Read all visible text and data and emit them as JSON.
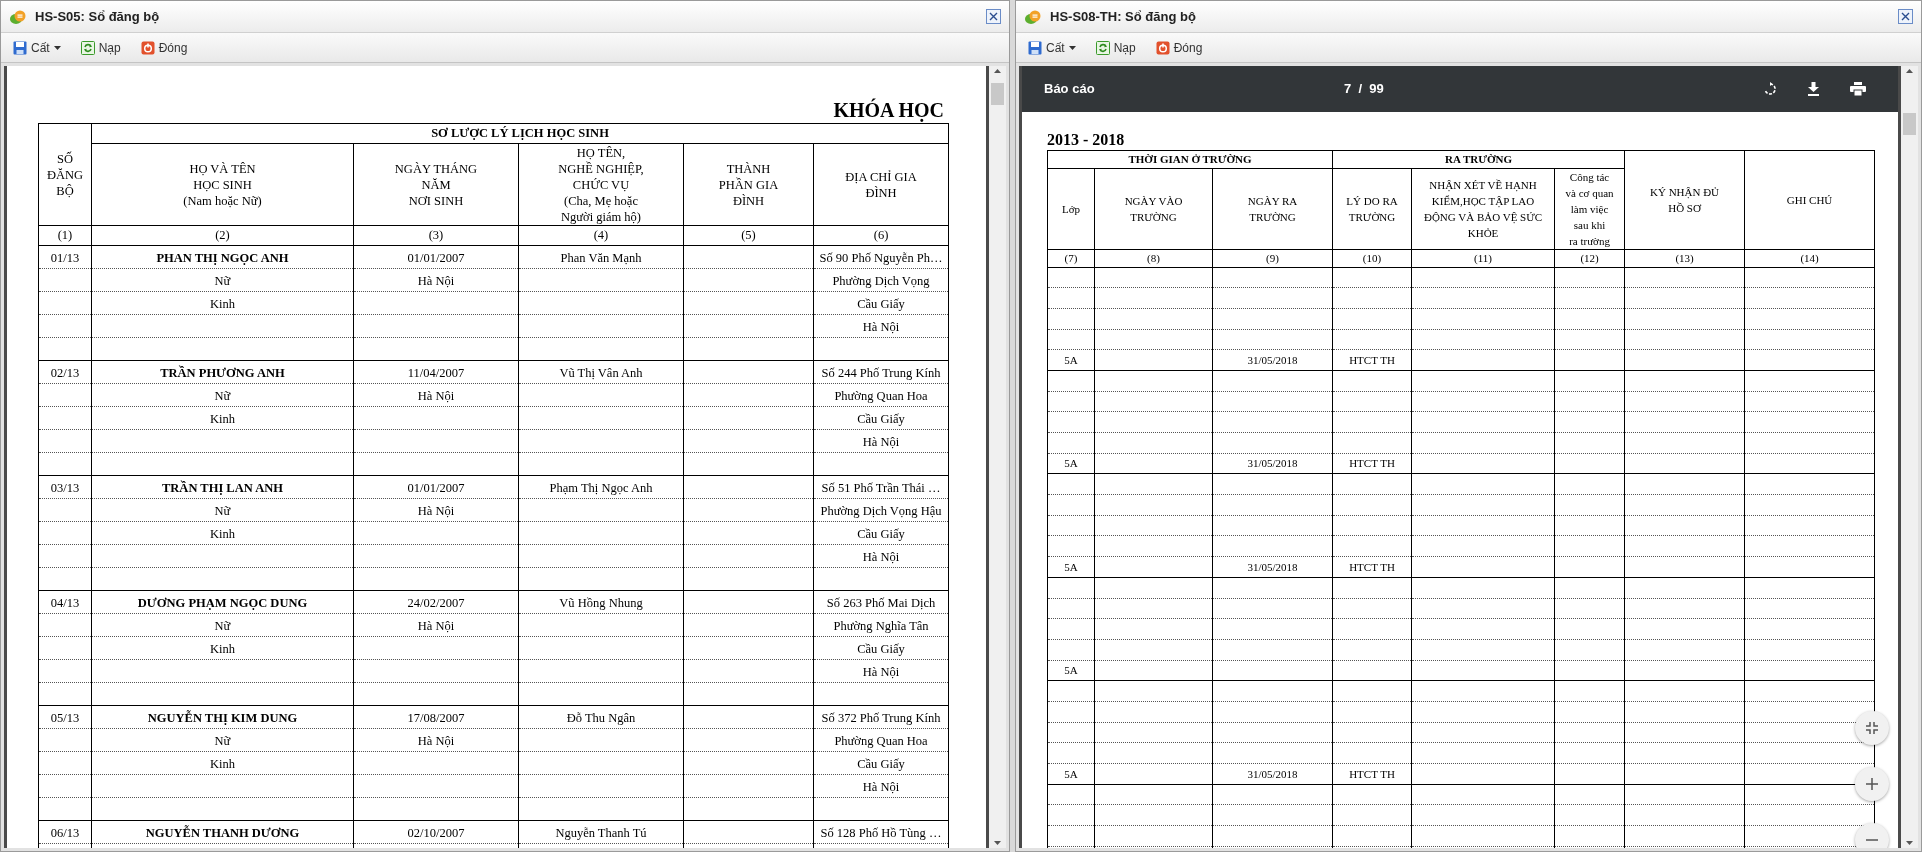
{
  "windows": [
    {
      "title": "HS-S05: Sổ đăng bộ",
      "kind": "register",
      "toolbar": [
        {
          "label": "Cất",
          "kind": "save",
          "has_menu": true
        },
        {
          "label": "Nạp",
          "kind": "reload",
          "has_menu": false
        },
        {
          "label": "Đóng",
          "kind": "close",
          "has_menu": false
        }
      ],
      "report": {
        "heading": "KHÓA HỌC",
        "first_column": {
          "heading": "SỐ\nĐĂNG\nBỘ",
          "number": "(1)"
        },
        "header_group": {
          "label": "SƠ LƯỢC LÝ LỊCH HỌC SINH",
          "columns": [
            {
              "heading": "HỌ VÀ TÊN\nHỌC SINH\n(Nam hoặc Nữ)",
              "number": "(2)"
            },
            {
              "heading": "NGÀY THÁNG\nNĂM\nNƠI SINH",
              "number": "(3)"
            },
            {
              "heading": "HỌ TÊN,\nNGHỀ NGHIỆP,\nCHỨC VỤ\n(Cha, Mẹ hoặc\nNgười giám hộ)",
              "number": "(4)"
            },
            {
              "heading": "THÀNH\nPHẦN GIA\nĐÌNH",
              "number": "(5)"
            },
            {
              "heading": "ĐỊA CHỈ GIA\nĐÌNH",
              "number": "(6)"
            }
          ]
        },
        "students": [
          {
            "register_no": "01/13",
            "name": "PHAN THỊ NGỌC ANH",
            "birth_date": "01/01/2007",
            "guardian": "Phan Văn Mạnh",
            "gender": "Nữ",
            "birth_place": "Hà Nội",
            "ethnicity": "Kinh",
            "address": [
              "Số 90 Phố Nguyễn Ph…",
              "Phường Dịch Vọng",
              "Cầu Giấy",
              "Hà Nội"
            ]
          },
          {
            "register_no": "02/13",
            "name": "TRẦN PHƯƠNG ANH",
            "birth_date": "11/04/2007",
            "guardian": "Vũ Thị Vân Anh",
            "gender": "Nữ",
            "birth_place": "Hà Nội",
            "ethnicity": "Kinh",
            "address": [
              "Số 244 Phố Trung Kính",
              "Phường Quan Hoa",
              "Cầu Giấy",
              "Hà Nội"
            ]
          },
          {
            "register_no": "03/13",
            "name": "TRẦN THỊ LAN ANH",
            "birth_date": "01/01/2007",
            "guardian": "Phạm Thị Ngọc Anh",
            "gender": "Nữ",
            "birth_place": "Hà Nội",
            "ethnicity": "Kinh",
            "address": [
              "Số 51 Phố Trần Thái …",
              "Phường Dịch Vọng Hậu",
              "Cầu Giấy",
              "Hà Nội"
            ]
          },
          {
            "register_no": "04/13",
            "name": "DƯƠNG PHẠM NGỌC DUNG",
            "birth_date": "24/02/2007",
            "guardian": "Vũ Hồng Nhung",
            "gender": "Nữ",
            "birth_place": "Hà Nội",
            "ethnicity": "Kinh",
            "address": [
              "Số 263 Phố Mai Dịch",
              "Phường Nghĩa Tân",
              "Cầu Giấy",
              "Hà Nội"
            ]
          },
          {
            "register_no": "05/13",
            "name": "NGUYỄN THỊ KIM DUNG",
            "birth_date": "17/08/2007",
            "guardian": "Đỗ Thu Ngân",
            "gender": "Nữ",
            "birth_place": "Hà Nội",
            "ethnicity": "Kinh",
            "address": [
              "Số 372 Phố Trung Kính",
              "Phường Quan Hoa",
              "Cầu Giấy",
              "Hà Nội"
            ]
          },
          {
            "register_no": "06/13",
            "name": "NGUYỄN THANH DƯƠNG",
            "birth_date": "02/10/2007",
            "guardian": "Nguyễn Thanh Tú",
            "address": [
              "Số 128 Phố Hồ Tùng …"
            ]
          }
        ]
      }
    },
    {
      "title": "HS-S08-TH: Sổ đăng bộ",
      "kind": "viewer",
      "toolbar": [
        {
          "label": "Cất",
          "kind": "save",
          "has_menu": true
        },
        {
          "label": "Nạp",
          "kind": "reload",
          "has_menu": false
        },
        {
          "label": "Đóng",
          "kind": "close",
          "has_menu": false
        }
      ],
      "viewer": {
        "title": "Báo cáo",
        "page_indicator": "7  /  99"
      },
      "report": {
        "heading": "2013 - 2018",
        "header_groups": [
          {
            "label": "THỜI GIAN Ở TRƯỜNG",
            "columns": [
              {
                "heading": "Lớp",
                "number": "(7)"
              },
              {
                "heading": "NGÀY VÀO\nTRƯỜNG",
                "number": "(8)"
              },
              {
                "heading": "NGÀY RA\nTRƯỜNG",
                "number": "(9)"
              }
            ]
          },
          {
            "label": "RA TRƯỜNG",
            "columns": [
              {
                "heading": "LÝ DO RA\nTRƯỜNG",
                "number": "(10)"
              },
              {
                "heading": "NHẬN XÉT VỀ HẠNH\nKIỂM,HỌC TẬP LAO\nĐỘNG VÀ BẢO VỆ SỨC\nKHỎE",
                "number": "(11)"
              },
              {
                "heading": "Công tác\nvà cơ quan\nlàm việc\nsau khi\nra trường",
                "number": "(12)"
              }
            ]
          }
        ],
        "side_columns": [
          {
            "heading": "KÝ NHẬN ĐỦ\nHỒ SƠ",
            "number": "(13)"
          },
          {
            "heading": "GHI CHÚ",
            "number": "(14)"
          }
        ],
        "records": [
          {
            "class": "5A",
            "exit_date": "31/05/2018",
            "reason": "HTCT TH"
          },
          {
            "class": "5A",
            "exit_date": "31/05/2018",
            "reason": "HTCT TH"
          },
          {
            "class": "5A",
            "exit_date": "31/05/2018",
            "reason": "HTCT TH"
          },
          {
            "class": "5A"
          },
          {
            "class": "5A",
            "exit_date": "31/05/2018",
            "reason": "HTCT TH"
          }
        ]
      }
    }
  ]
}
